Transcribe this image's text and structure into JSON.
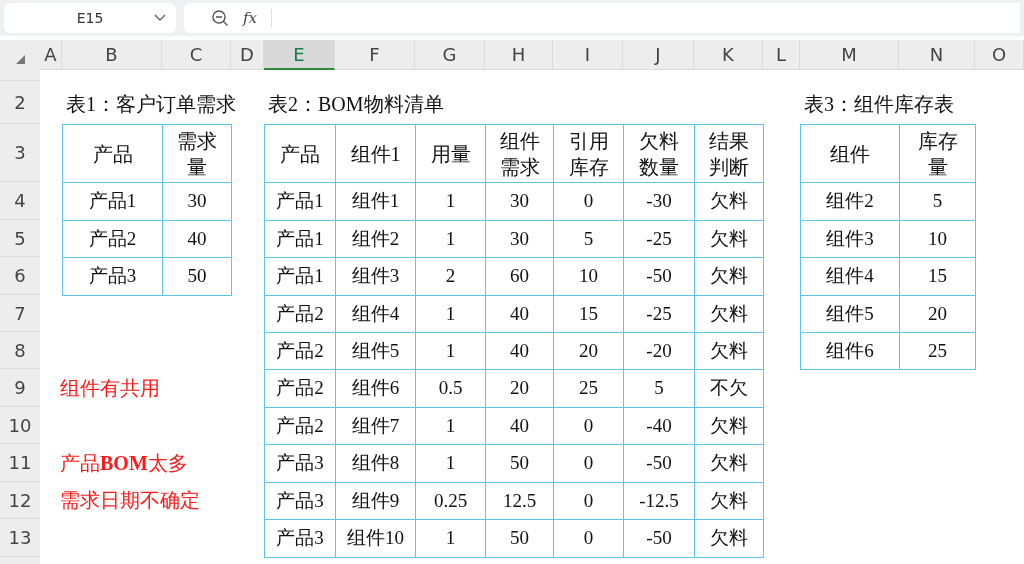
{
  "toolbar": {
    "cell_ref": "E15",
    "formula_label": "fx"
  },
  "columns": [
    {
      "label": "A",
      "selected": false
    },
    {
      "label": "B",
      "selected": false
    },
    {
      "label": "C",
      "selected": false
    },
    {
      "label": "D",
      "selected": false
    },
    {
      "label": "E",
      "selected": true
    },
    {
      "label": "F",
      "selected": false
    },
    {
      "label": "G",
      "selected": false
    },
    {
      "label": "H",
      "selected": false
    },
    {
      "label": "I",
      "selected": false
    },
    {
      "label": "J",
      "selected": false
    },
    {
      "label": "K",
      "selected": false
    },
    {
      "label": "L",
      "selected": false
    },
    {
      "label": "M",
      "selected": false
    },
    {
      "label": "N",
      "selected": false
    },
    {
      "label": "O",
      "selected": false
    }
  ],
  "rows": [
    "2",
    "3",
    "4",
    "5",
    "6",
    "7",
    "8",
    "9",
    "10",
    "11",
    "12",
    "13"
  ],
  "tables": [
    {
      "title": "表1：客户订单需求",
      "headers": [
        "产品",
        "需求量"
      ],
      "rows": [
        [
          "产品1",
          "30"
        ],
        [
          "产品2",
          "40"
        ],
        [
          "产品3",
          "50"
        ]
      ]
    },
    {
      "title": "表2：BOM物料清单",
      "headers": [
        "产品",
        "组件1",
        "用量",
        "组件需求",
        "引用库存",
        "欠料数量",
        "结果判断"
      ],
      "rows": [
        [
          "产品1",
          "组件1",
          "1",
          "30",
          "0",
          "-30",
          "欠料"
        ],
        [
          "产品1",
          "组件2",
          "1",
          "30",
          "5",
          "-25",
          "欠料"
        ],
        [
          "产品1",
          "组件3",
          "2",
          "60",
          "10",
          "-50",
          "欠料"
        ],
        [
          "产品2",
          "组件4",
          "1",
          "40",
          "15",
          "-25",
          "欠料"
        ],
        [
          "产品2",
          "组件5",
          "1",
          "40",
          "20",
          "-20",
          "欠料"
        ],
        [
          "产品2",
          "组件6",
          "0.5",
          "20",
          "25",
          "5",
          "不欠"
        ],
        [
          "产品2",
          "组件7",
          "1",
          "40",
          "0",
          "-40",
          "欠料"
        ],
        [
          "产品3",
          "组件8",
          "1",
          "50",
          "0",
          "-50",
          "欠料"
        ],
        [
          "产品3",
          "组件9",
          "0.25",
          "12.5",
          "0",
          "-12.5",
          "欠料"
        ],
        [
          "产品3",
          "组件10",
          "1",
          "50",
          "0",
          "-50",
          "欠料"
        ]
      ]
    },
    {
      "title": "表3：组件库存表",
      "headers": [
        "组件",
        "库存量"
      ],
      "rows": [
        [
          "组件2",
          "5"
        ],
        [
          "组件3",
          "10"
        ],
        [
          "组件4",
          "15"
        ],
        [
          "组件5",
          "20"
        ],
        [
          "组件6",
          "25"
        ]
      ]
    }
  ],
  "notes": [
    "组件有共用",
    "产品**BOM**太多",
    "需求日期不确定"
  ]
}
